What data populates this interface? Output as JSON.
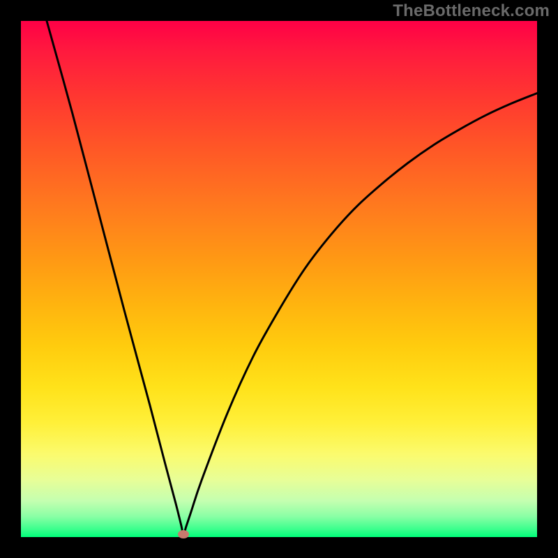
{
  "watermark": "TheBottleneck.com",
  "chart_data": {
    "type": "line",
    "title": "",
    "xlabel": "",
    "ylabel": "",
    "xlim": [
      0,
      100
    ],
    "ylim": [
      0,
      100
    ],
    "series": [
      {
        "name": "curve",
        "x": [
          5,
          10,
          15,
          20,
          25,
          28,
          30,
          31,
          31.5,
          32,
          33,
          35,
          40,
          45,
          50,
          55,
          60,
          65,
          70,
          75,
          80,
          85,
          90,
          95,
          100
        ],
        "y": [
          100,
          82,
          63,
          44,
          25.5,
          14,
          6.5,
          2.5,
          0.5,
          2,
          5,
          11,
          24,
          35,
          44,
          52,
          58.5,
          64,
          68.5,
          72.5,
          76,
          79,
          81.7,
          84,
          86
        ]
      }
    ],
    "marker": {
      "x": 31.5,
      "y": 0.5,
      "color": "#c97a6e"
    },
    "background_gradient": {
      "top": "#ff0046",
      "bottom": "#00ff7a"
    },
    "grid": false,
    "legend": false
  }
}
